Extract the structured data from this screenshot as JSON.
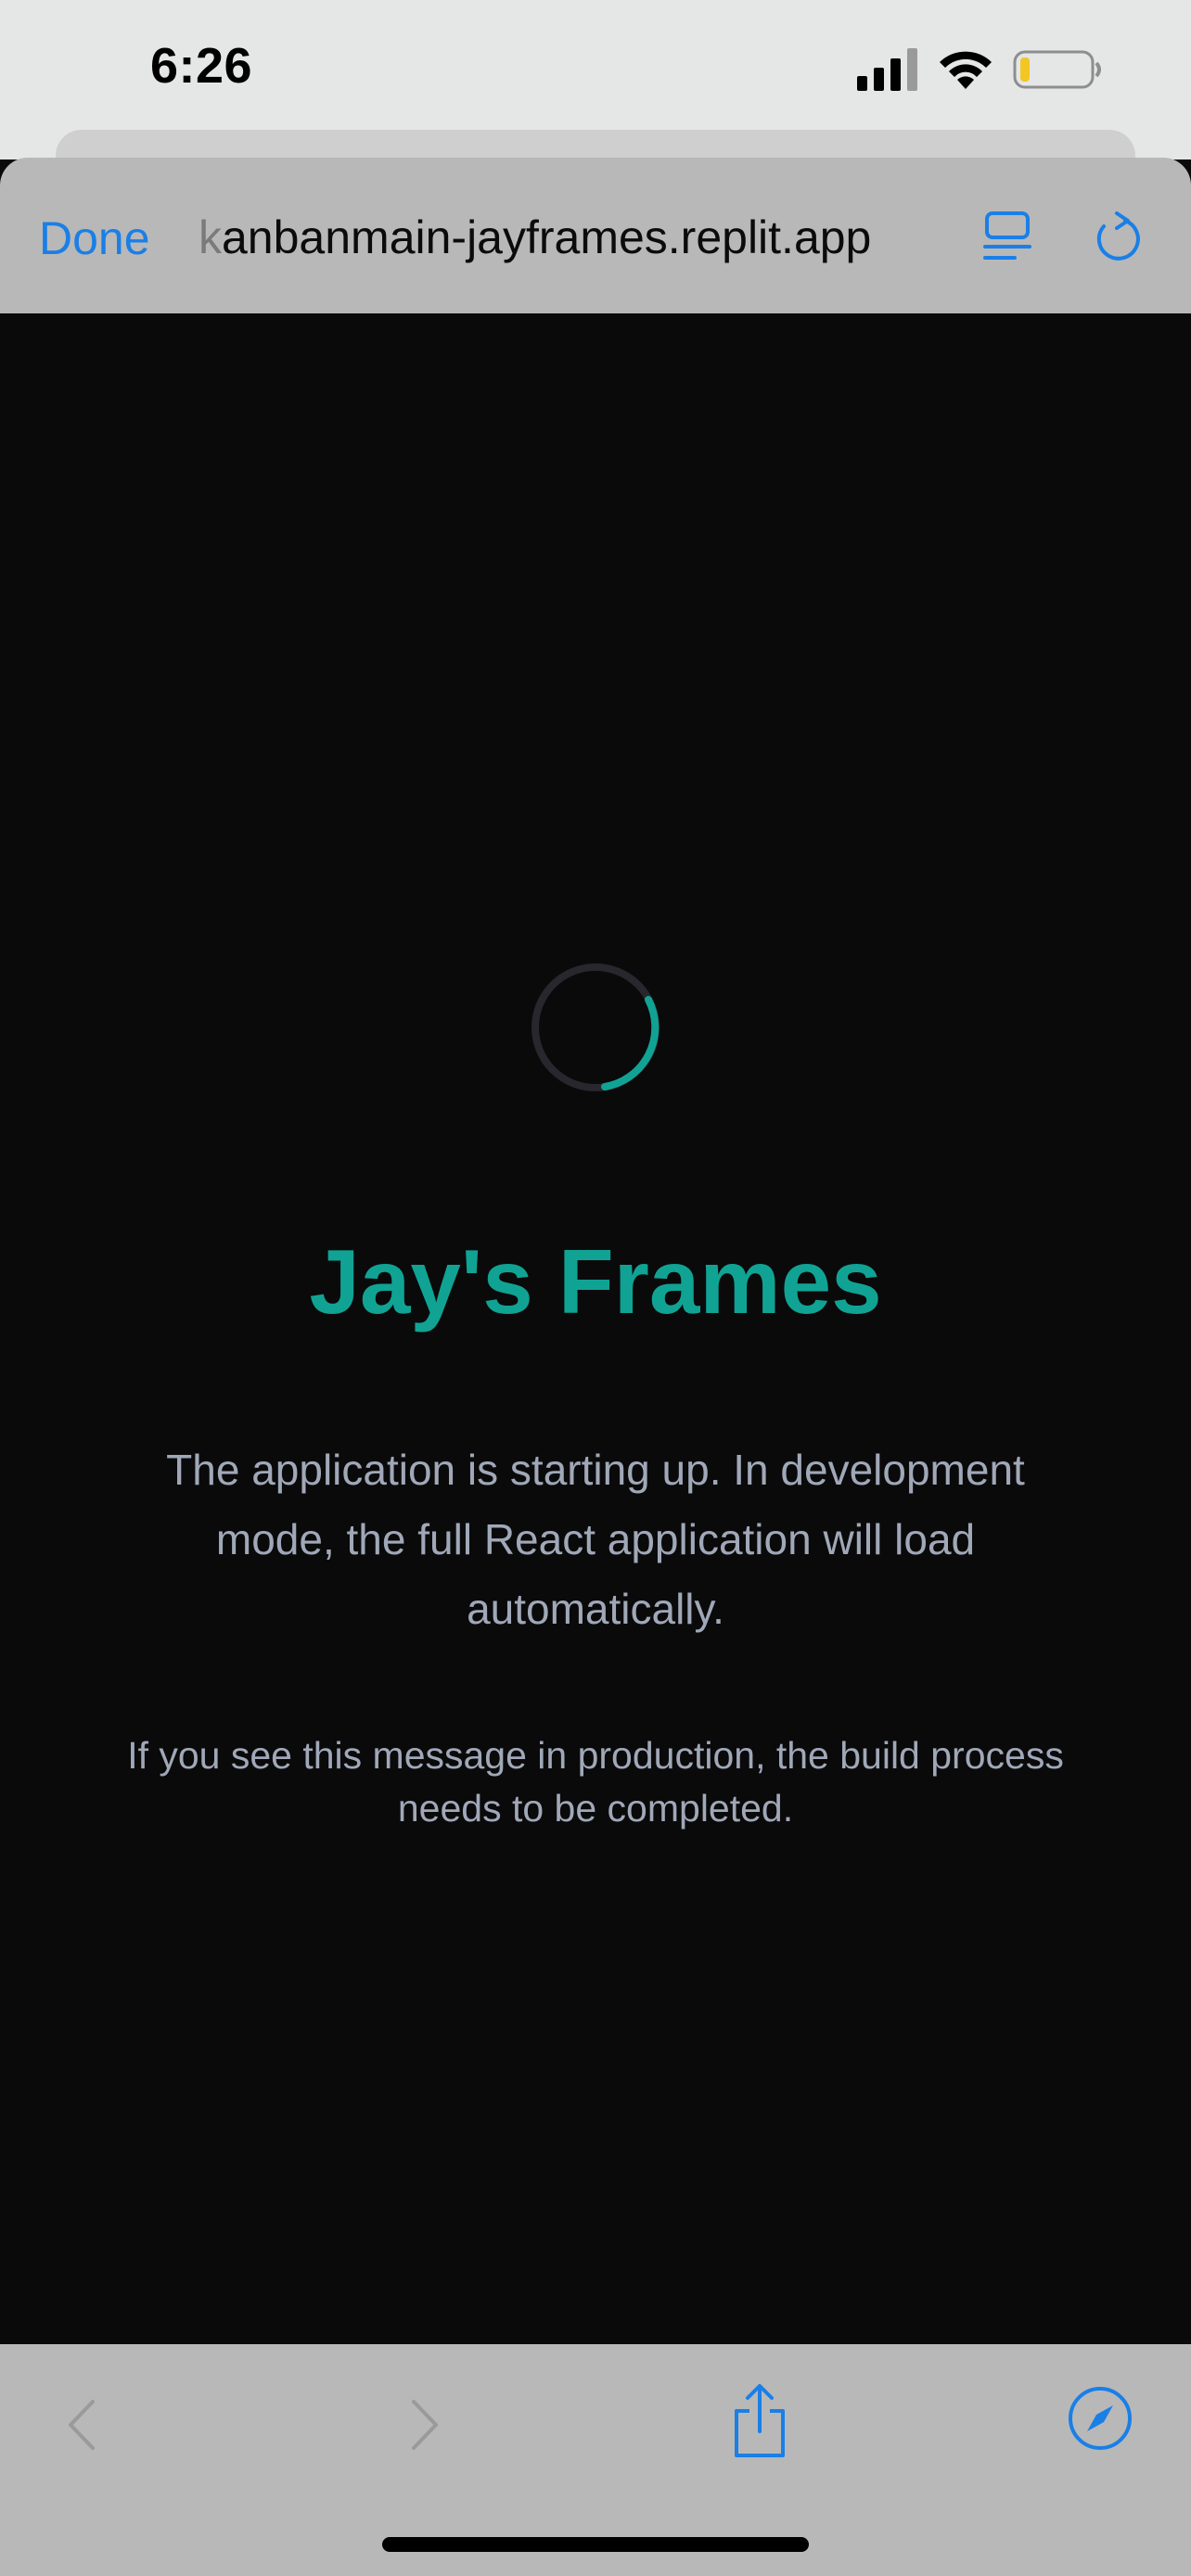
{
  "status_bar": {
    "time": "6:26"
  },
  "browser": {
    "done_label": "Done",
    "url_hidden_prefix": "k",
    "url_visible": "anbanmain-jayframes.replit.app",
    "reader_icon": "reader-icon",
    "reload_icon": "reload-icon"
  },
  "page": {
    "title": "Jay's Frames",
    "message": "The application is starting up. In development mode, the full React application will load automatically.",
    "note": "If you see this message in production, the build process needs to be completed."
  },
  "toolbar": {
    "icons": [
      "chevron-left-icon",
      "chevron-right-icon",
      "share-icon",
      "compass-icon"
    ]
  },
  "colors": {
    "accent": "#10a394",
    "link_blue": "#1a7fe6",
    "text_muted": "#a0a8b8",
    "background": "#0a0a0b",
    "chrome": "#b8b8b8"
  }
}
